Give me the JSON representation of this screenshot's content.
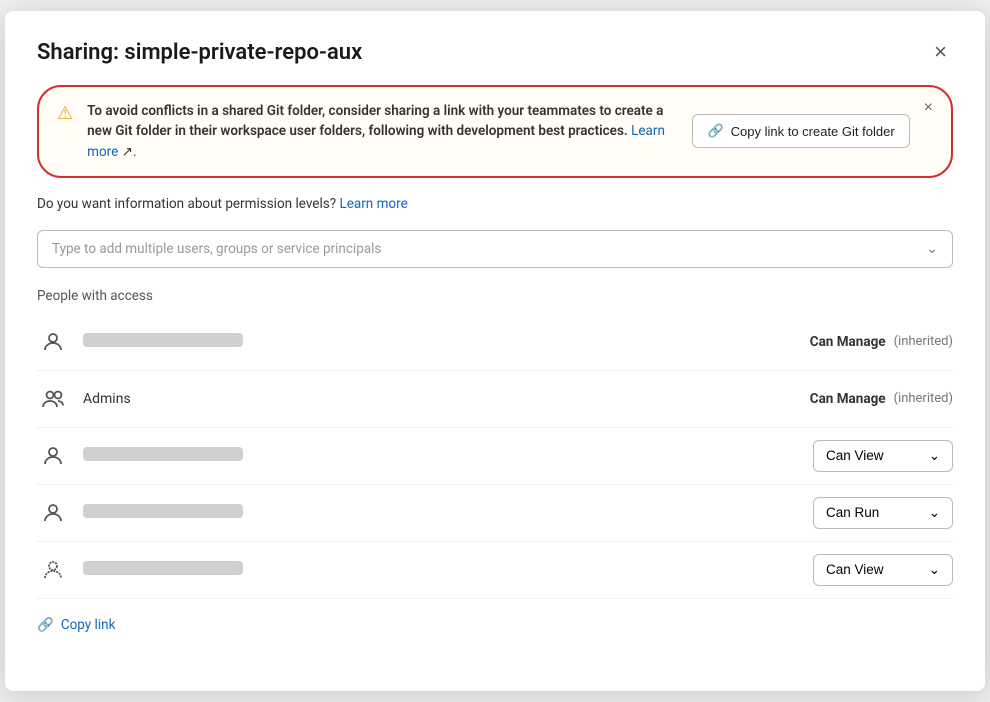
{
  "modal": {
    "title": "Sharing: simple-private-repo-aux",
    "close_label": "×"
  },
  "warning": {
    "text_bold": "To avoid conflicts in a shared Git folder, consider sharing a link with your teammates to create a new Git folder in their workspace user folders, following with development best practices.",
    "learn_more_label": "Learn more",
    "copy_btn_label": "Copy link to create Git folder",
    "dismiss_label": "×",
    "icon": "⚠"
  },
  "permission_info": {
    "text": "Do you want information about permission levels?",
    "learn_more_label": "Learn more"
  },
  "search": {
    "placeholder": "Type to add multiple users, groups or service principals"
  },
  "section_label": "People with access",
  "people": [
    {
      "id": "user1",
      "name_blur": true,
      "name": "",
      "permission_type": "static",
      "permission": "Can Manage",
      "inherited": "(inherited)",
      "avatar_type": "single"
    },
    {
      "id": "user2",
      "name_blur": false,
      "name": "Admins",
      "permission_type": "static",
      "permission": "Can Manage",
      "inherited": "(inherited)",
      "avatar_type": "group"
    },
    {
      "id": "user3",
      "name_blur": true,
      "name": "",
      "permission_type": "dropdown",
      "permission": "Can View",
      "inherited": "",
      "avatar_type": "single"
    },
    {
      "id": "user4",
      "name_blur": true,
      "name": "",
      "permission_type": "dropdown",
      "permission": "Can Run",
      "inherited": "",
      "avatar_type": "single"
    },
    {
      "id": "user5",
      "name_blur": true,
      "name": "",
      "permission_type": "dropdown",
      "permission": "Can View",
      "inherited": "",
      "avatar_type": "single-outline"
    }
  ],
  "footer": {
    "copy_link_label": "Copy link",
    "link_icon": "🔗"
  }
}
